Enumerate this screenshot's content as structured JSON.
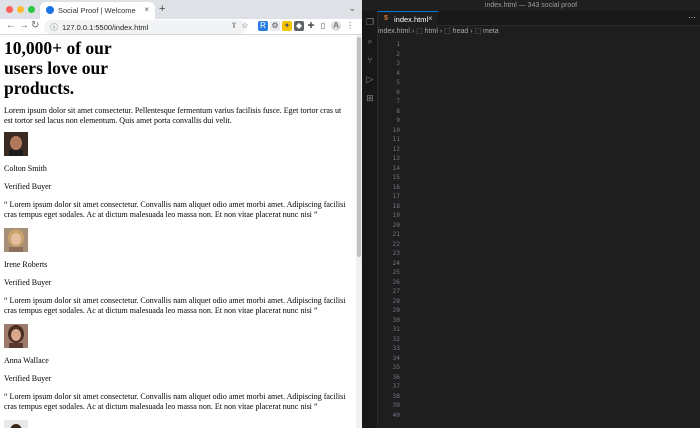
{
  "browser": {
    "tab_title": "Social Proof | Welcome",
    "url": "127.0.0.1:5500/index.html",
    "new_tab": "+",
    "nav": {
      "back": "←",
      "forward": "→",
      "reload": "↻"
    }
  },
  "page": {
    "heading": "10,000+ of our users love our products.",
    "intro": "Lorem ipsum dolor sit amet consectetur. Pellentesque fermentum varius facilisis fusce. Eget tortor cras ut est tortor sed lacus non elementum. Quis amet porta convallis dui velit.",
    "testimonials": [
      {
        "name": "Colton Smith",
        "role": "Verified Buyer",
        "quote": "“ Lorem ipsum dolor sit amet consectetur. Convallis nam aliquet odio amet morbi amet. Adipiscing facilisi cras tempus eget sodales. Ac at dictum malesuada leo massa non. Et non vitae placerat nunc nisi ”"
      },
      {
        "name": "Irene Roberts",
        "role": "Verified Buyer",
        "quote": "“ Lorem ipsum dolor sit amet consectetur. Convallis nam aliquet odio amet morbi amet. Adipiscing facilisi cras tempus eget sodales. Ac at dictum malesuada leo massa non. Et non vitae placerat nunc nisi ”"
      },
      {
        "name": "Anna Wallace",
        "role": "Verified Buyer",
        "quote": "“ Lorem ipsum dolor sit amet consectetur. Convallis nam aliquet odio amet morbi amet. Adipiscing facilisi cras tempus eget sodales. Ac at dictum malesuada leo massa non. Et non vitae placerat nunc nisi ”"
      }
    ]
  },
  "editor": {
    "window_title": "index.html — 343 social proof",
    "tab_label": "index.html",
    "breadcrumbs": "index.html  ›  ⬚ html  ›  ⬚ head  ›  ⬚ meta",
    "line_numbers": [
      "1",
      "2",
      "3",
      "4",
      "5",
      "6",
      "7",
      "8",
      "9",
      "10",
      "11",
      "12",
      "13",
      "14",
      "15",
      "16",
      "17",
      "18",
      "19",
      "20",
      "21",
      "22",
      "23",
      "24",
      "25",
      "26",
      "27",
      "28",
      "29",
      "30",
      "31",
      "32",
      "33",
      "34",
      "35",
      "36",
      "37",
      "38",
      "39",
      "40"
    ]
  },
  "colors": {
    "tag": "#569cd6",
    "attr": "#9cdcfe",
    "value": "#ce9178",
    "text": "#d4d4d4",
    "accent": "#0078d4"
  }
}
